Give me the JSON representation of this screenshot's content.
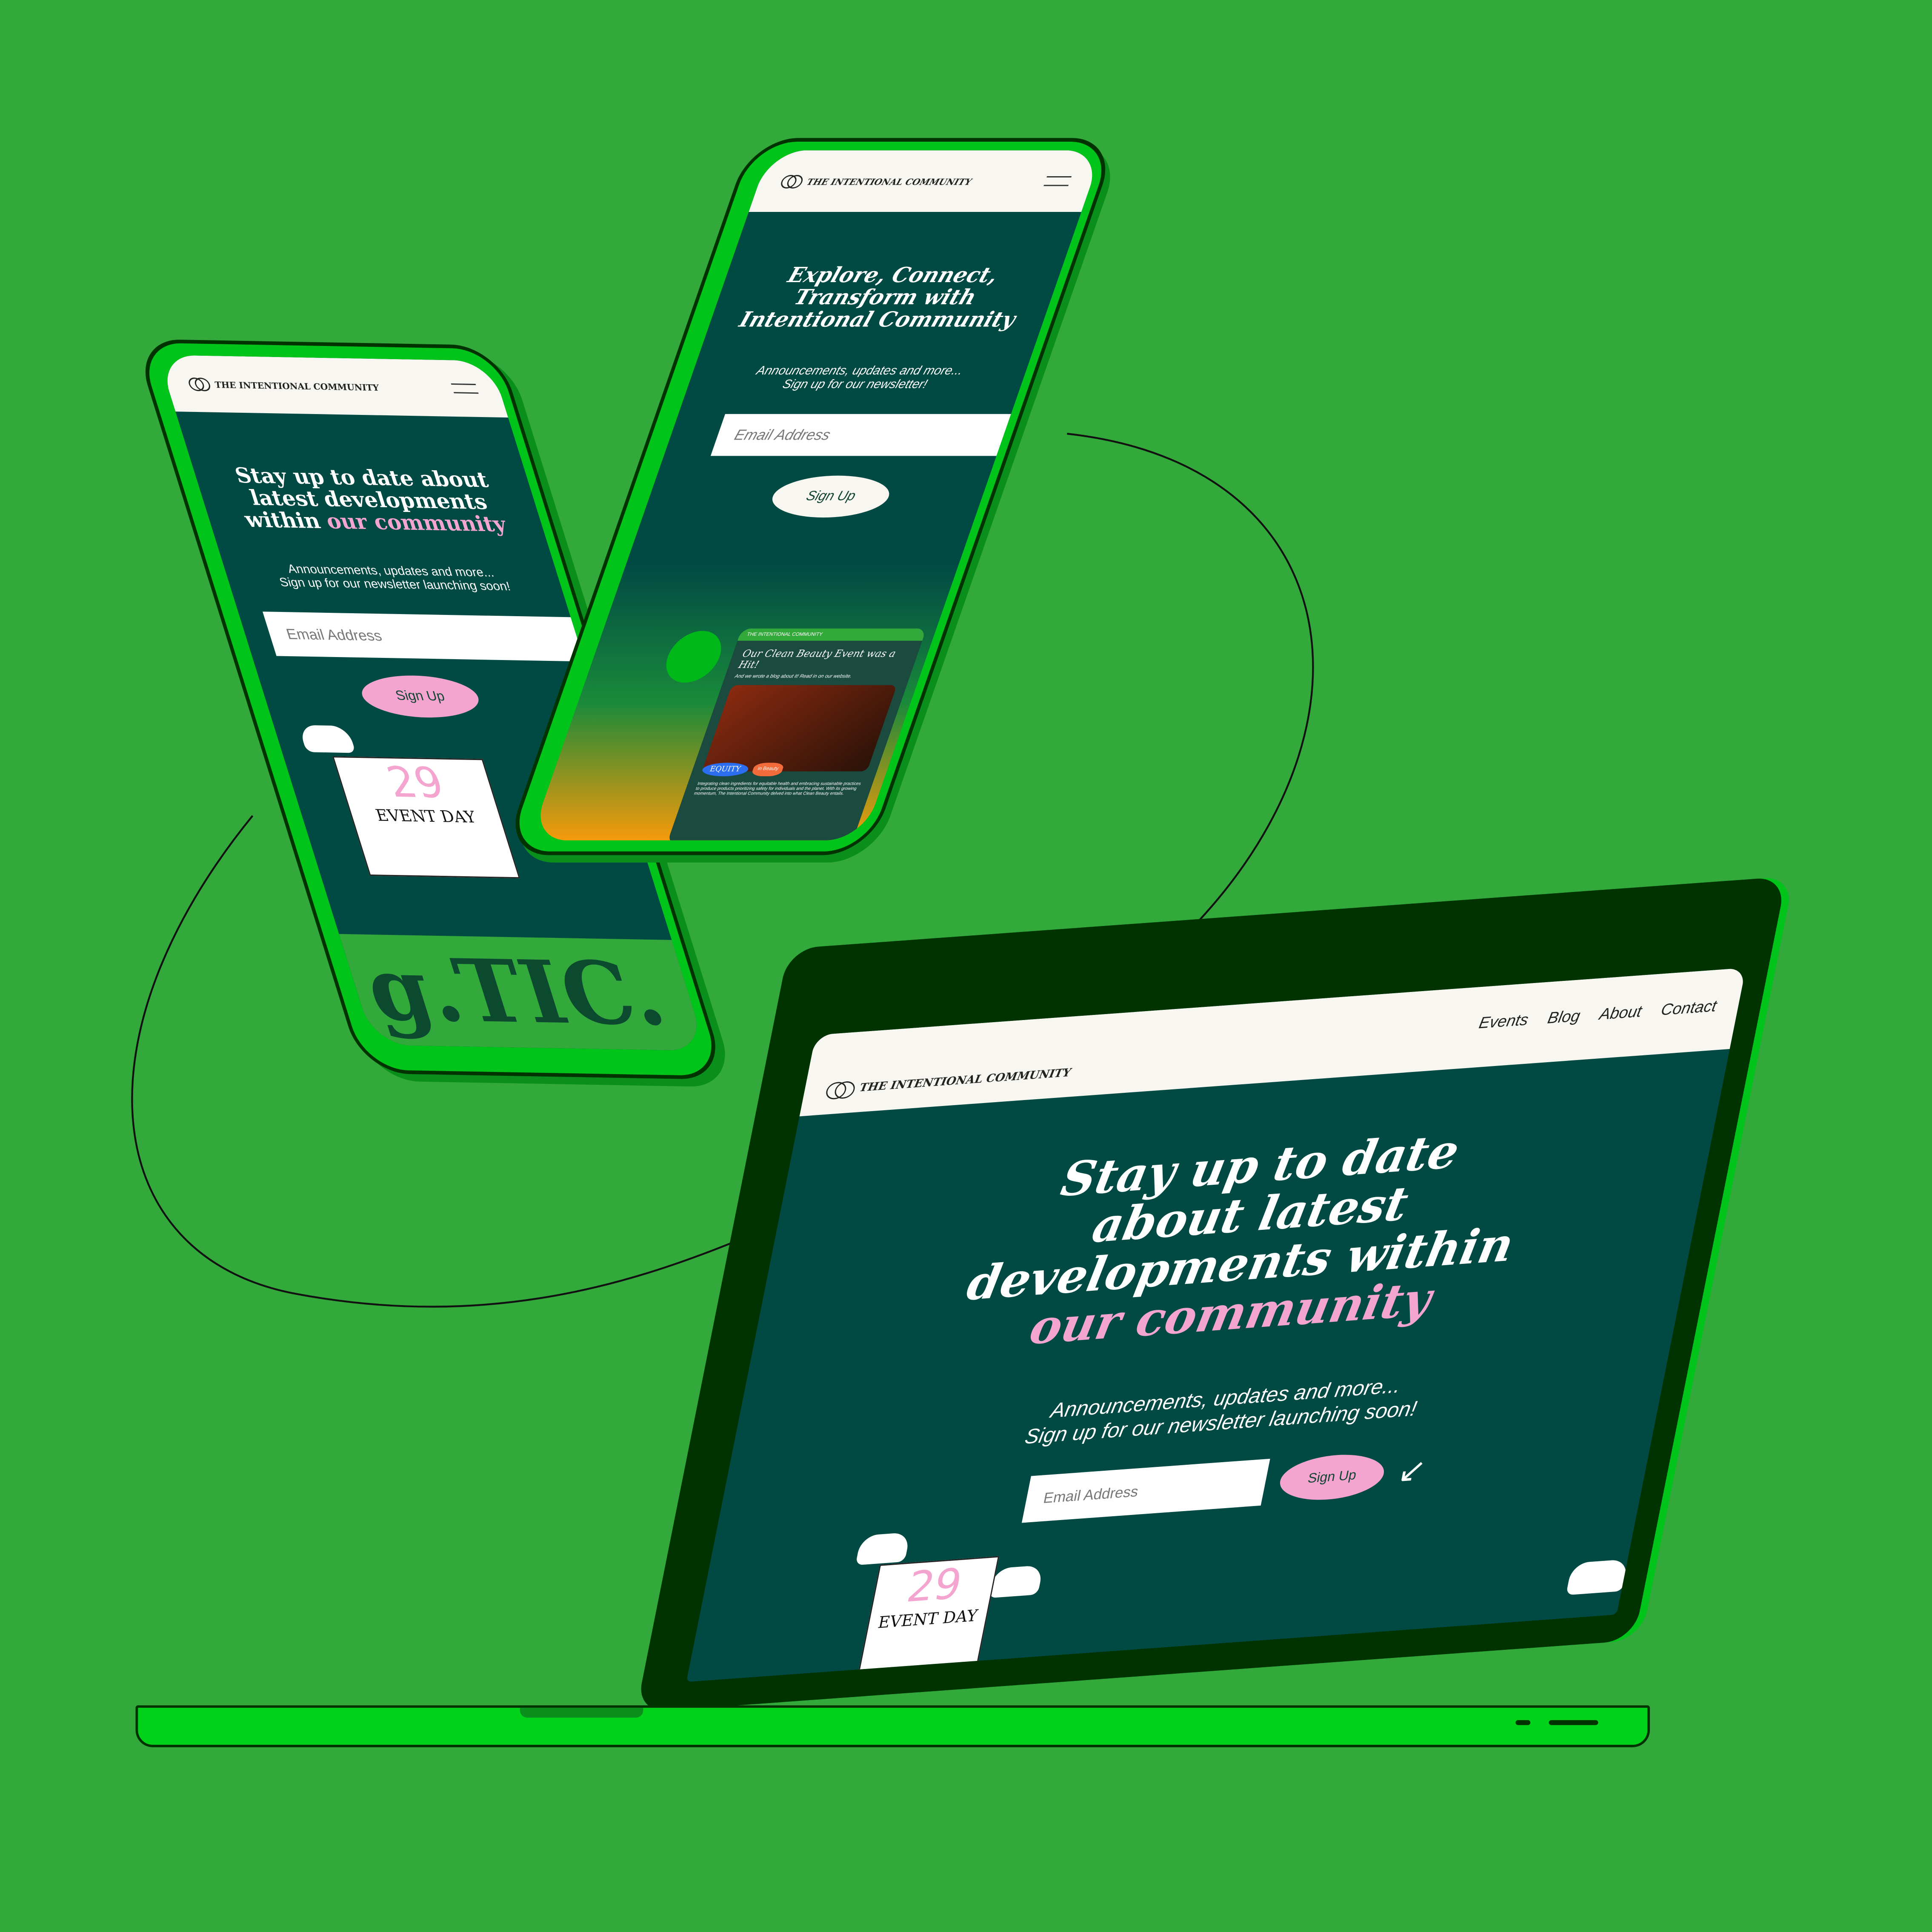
{
  "brand": "THE INTENTIONAL COMMUNITY",
  "colors": {
    "background": "#33a93c",
    "screen": "#014a44",
    "accent_pink": "#f4a5cf",
    "device": "#00c41a",
    "header": "#f8f6f0"
  },
  "left_phone": {
    "headline_part1": "Stay up to date about latest developments within",
    "headline_highlight": "our community",
    "subtext_line1": "Announcements, updates and more...",
    "subtext_line2": "Sign up for our newsletter launching soon!",
    "email_placeholder": "Email Address",
    "signup_label": "Sign Up",
    "calendar_day": "29",
    "calendar_label": "EVENT DAY",
    "marquee": "g.TIC."
  },
  "center_phone": {
    "headline": "Explore, Connect, Transform with Intentional Community",
    "subtext_line1": "Announcements, updates and more...",
    "subtext_line2": "Sign up for our newsletter!",
    "email_placeholder": "Email Address",
    "signup_label": "Sign Up",
    "card": {
      "title": "Our Clean Beauty Event was a Hit!",
      "subtitle": "And we wrote a blog about it! Read in on our website.",
      "badge1": "EQUITY",
      "badge2": "in Beauty",
      "body": "Integrating clean ingredients for equitable health and embracing sustainable practices to produce products prioritizing safety for individuals and the planet. With its growing momentum, The Intentional Community delved into what Clean Beauty entails."
    }
  },
  "laptop": {
    "nav": [
      {
        "label": "Events"
      },
      {
        "label": "Blog"
      },
      {
        "label": "About"
      },
      {
        "label": "Contact"
      }
    ],
    "headline_part1": "Stay up to date about latest developments within",
    "headline_highlight": "our community",
    "subtext_line1": "Announcements, updates and more...",
    "subtext_line2": "Sign up for our newsletter launching soon!",
    "email_placeholder": "Email Address",
    "signup_label": "Sign Up",
    "calendar_day": "29",
    "calendar_label": "EVENT DAY"
  }
}
